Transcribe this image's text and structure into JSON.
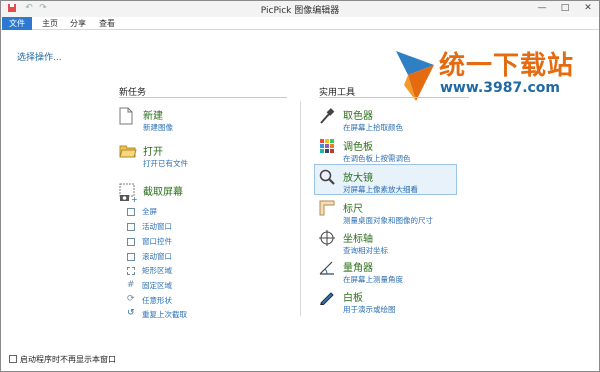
{
  "window": {
    "title": "PicPick 图像编辑器"
  },
  "quick_access": [
    "save-icon",
    "undo-icon",
    "redo-icon"
  ],
  "window_controls": {
    "minimize": "—",
    "maximize": "□",
    "close": "✕"
  },
  "ribbon": {
    "tabs": [
      {
        "label": "文件",
        "active": true
      },
      {
        "label": "主页"
      },
      {
        "label": "分享"
      },
      {
        "label": "查看"
      }
    ]
  },
  "hint": "选择操作...",
  "logo": {
    "text": "统一下载站",
    "url": "www.3987.com"
  },
  "new_tasks": {
    "title": "新任务",
    "new": {
      "label": "新建",
      "desc": "新建图像"
    },
    "open": {
      "label": "打开",
      "desc": "打开已有文件"
    },
    "capture": {
      "label": "截取屏幕"
    },
    "capture_items": [
      "全屏",
      "活动窗口",
      "窗口控件",
      "滚动窗口",
      "矩形区域",
      "固定区域",
      "任意形状",
      "重复上次截取"
    ]
  },
  "tools": {
    "title": "实用工具",
    "items": [
      {
        "label": "取色器",
        "desc": "在屏幕上拾取颜色"
      },
      {
        "label": "调色板",
        "desc": "在调色板上按需调色"
      },
      {
        "label": "放大镜",
        "desc": "对屏幕上像素放大细看"
      },
      {
        "label": "标尺",
        "desc": "测量桌面对象和图像的尺寸"
      },
      {
        "label": "坐标轴",
        "desc": "查询相对坐标"
      },
      {
        "label": "量角器",
        "desc": "在屏幕上测量角度"
      },
      {
        "label": "白板",
        "desc": "用于演示或绘图"
      }
    ]
  },
  "footer": {
    "checkbox_label": "启动程序时不再显示本窗口"
  }
}
